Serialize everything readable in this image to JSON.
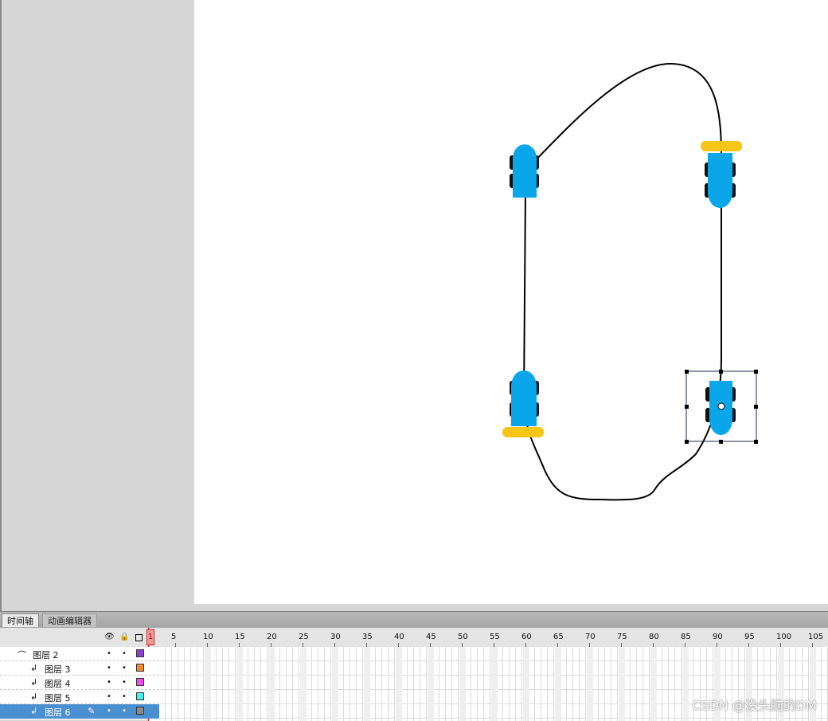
{
  "timeline": {
    "tabs": [
      {
        "label": "时间轴",
        "active": true
      },
      {
        "label": "动画编辑器",
        "active": false
      }
    ],
    "header_icons": [
      "eye-icon",
      "lock-icon",
      "outline-icon"
    ],
    "current_frame": "1",
    "ruler": [
      "5",
      "10",
      "15",
      "20",
      "25",
      "30",
      "35",
      "40",
      "45",
      "50",
      "55",
      "60",
      "65",
      "70",
      "75",
      "80",
      "85",
      "90",
      "95",
      "100",
      "105"
    ],
    "layers": [
      {
        "name": "图层 2",
        "type": "guide-layer-icon",
        "color": "#8b3fd1",
        "selected": false
      },
      {
        "name": "图层 3",
        "type": "guided-layer-icon",
        "color": "#f08a24",
        "selected": false
      },
      {
        "name": "图层 4",
        "type": "guided-layer-icon",
        "color": "#f04bf0",
        "selected": false
      },
      {
        "name": "图层 5",
        "type": "guided-layer-icon",
        "color": "#44f0f0",
        "selected": false
      },
      {
        "name": "图层 6",
        "type": "guided-layer-icon",
        "color": "#8a8a8a",
        "selected": true
      }
    ]
  },
  "stage": {
    "car_body_color": "#0aa6ea",
    "car_accent_color": "#f5c518",
    "path_color": "#000000"
  },
  "watermark": "CSDN @没头脑的DM"
}
